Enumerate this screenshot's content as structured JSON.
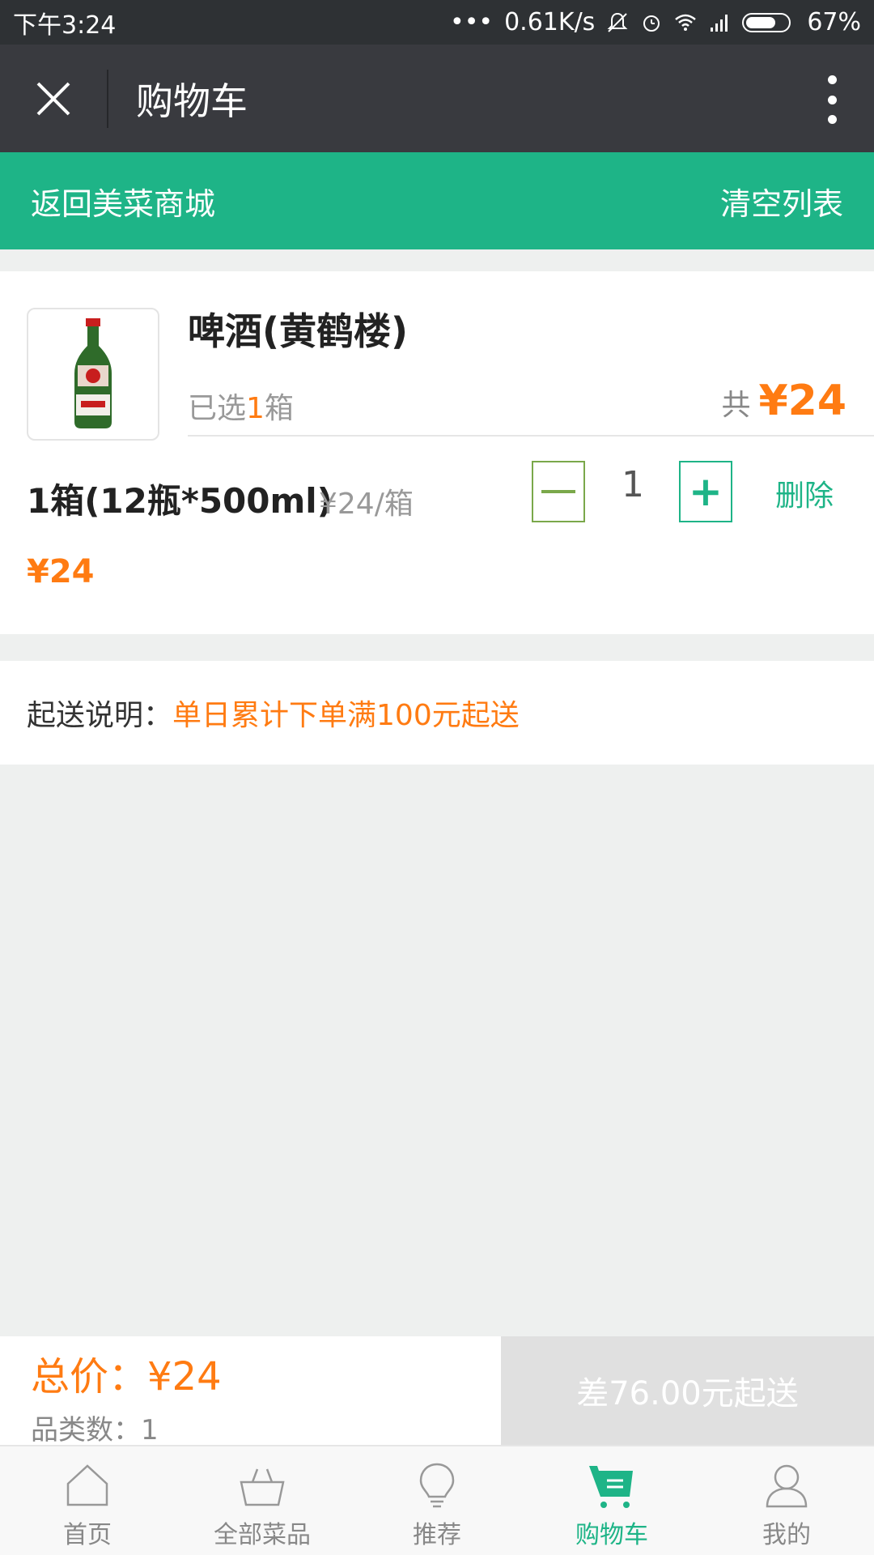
{
  "status_bar": {
    "time": "下午3:24",
    "network_speed": "0.61K/s",
    "battery": "67%"
  },
  "nav": {
    "title": "购物车"
  },
  "action_bar": {
    "back_label": "返回美菜商城",
    "clear_label": "清空列表"
  },
  "cart_item": {
    "name": "啤酒(黄鹤楼)",
    "selected_prefix": "已选",
    "selected_count": "1",
    "selected_unit": "箱",
    "total_label": "共",
    "total_value": "¥24",
    "spec": "1箱(12瓶*500ml)",
    "unit_price": "¥24/箱",
    "quantity": "1",
    "delete_label": "删除",
    "line_price": "¥24",
    "thumb_label": "黄鹤楼 啤酒"
  },
  "delivery_notice": {
    "label": "起送说明：",
    "text": "单日累计下单满100元起送"
  },
  "summary": {
    "total": "总价：¥24",
    "count": "品类数：1",
    "checkout_label": "差76.00元起送"
  },
  "tabs": [
    {
      "label": "首页",
      "icon": "home-icon"
    },
    {
      "label": "全部菜品",
      "icon": "basket-icon"
    },
    {
      "label": "推荐",
      "icon": "lightbulb-icon"
    },
    {
      "label": "购物车",
      "icon": "cart-icon",
      "active": true
    },
    {
      "label": "我的",
      "icon": "user-icon"
    }
  ],
  "colors": {
    "accent_green": "#1eb487",
    "price_orange": "#ff7b12",
    "nav_dark": "#393a3f"
  }
}
